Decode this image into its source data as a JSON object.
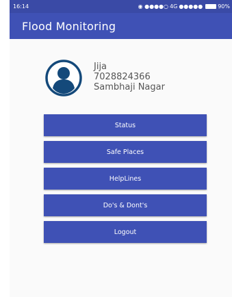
{
  "status_bar": {
    "time": "16:14",
    "network": "4G",
    "battery": "90%"
  },
  "app_bar": {
    "title": "Flood Monitoring"
  },
  "profile": {
    "avatar_icon": "person-circle-icon",
    "name": "Jija",
    "phone": "7028824366",
    "location": "Sambhaji Nagar"
  },
  "menu": {
    "buttons": [
      {
        "label": "Status"
      },
      {
        "label": "Safe Places"
      },
      {
        "label": "HelpLines"
      },
      {
        "label": "Do's & Dont's"
      },
      {
        "label": "Logout"
      }
    ]
  },
  "colors": {
    "primary": "#3f51b5",
    "status_bar": "#3a4aa6"
  }
}
